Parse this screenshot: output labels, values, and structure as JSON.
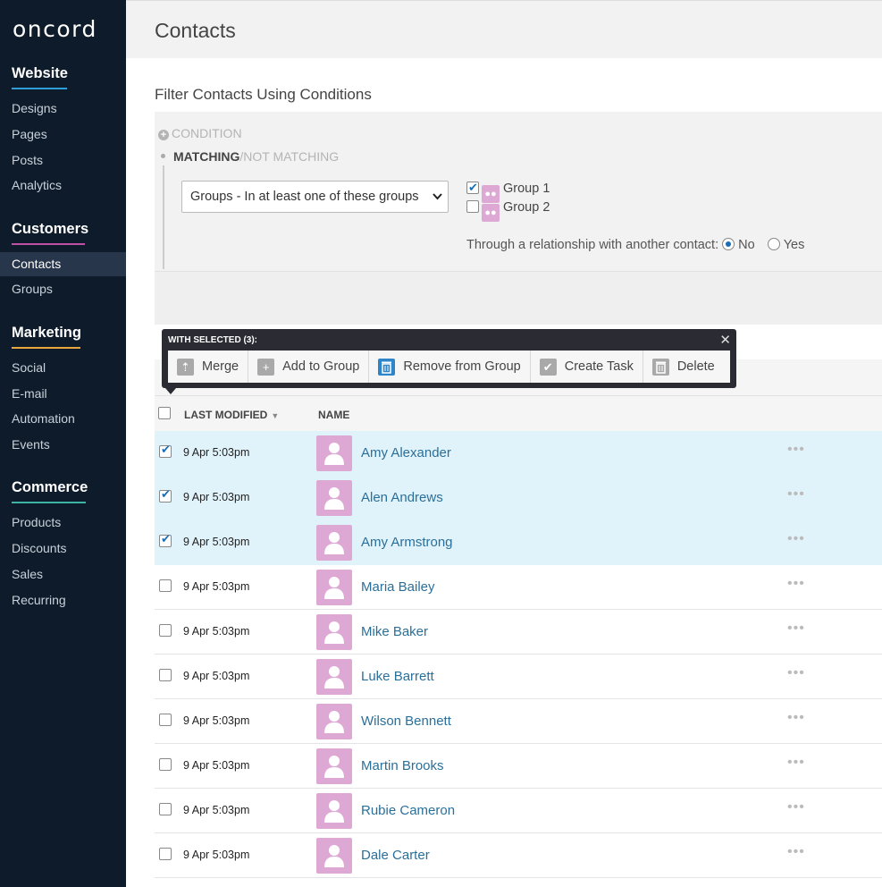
{
  "app": {
    "logo": "oncord"
  },
  "sidebar": {
    "sections": [
      {
        "title": "Website",
        "accent": "#2e9fd8",
        "items": [
          "Designs",
          "Pages",
          "Posts",
          "Analytics"
        ]
      },
      {
        "title": "Customers",
        "accent": "#c04fa6",
        "items": [
          "Contacts",
          "Groups"
        ]
      },
      {
        "title": "Marketing",
        "accent": "#e8a63c",
        "items": [
          "Social",
          "E-mail",
          "Automation",
          "Events"
        ]
      },
      {
        "title": "Commerce",
        "accent": "#3db5a6",
        "items": [
          "Products",
          "Discounts",
          "Sales",
          "Recurring"
        ]
      }
    ],
    "active": "Contacts"
  },
  "header": {
    "title": "Contacts"
  },
  "filter": {
    "heading": "Filter Contacts Using Conditions",
    "add_condition": "CONDITION",
    "matching": "MATCHING",
    "not_matching": "/NOT MATCHING",
    "select_value": "Groups - In at least one of these groups",
    "groups": [
      {
        "label": "Group 1",
        "checked": true
      },
      {
        "label": "Group 2",
        "checked": false
      }
    ],
    "relation_label": "Through a relationship with another contact:",
    "relation_no": "No",
    "relation_yes": "Yes",
    "relation_selected": "No"
  },
  "selection_bar": {
    "title": "WITH SELECTED (3):",
    "actions": [
      "Merge",
      "Add to Group",
      "Remove from Group",
      "Create Task",
      "Delete"
    ]
  },
  "table": {
    "columns": {
      "modified": "LAST MODIFIED",
      "name": "NAME"
    },
    "rows": [
      {
        "date": "9 Apr 5:03pm",
        "name": "Amy Alexander",
        "selected": true
      },
      {
        "date": "9 Apr 5:03pm",
        "name": "Alen Andrews",
        "selected": true
      },
      {
        "date": "9 Apr 5:03pm",
        "name": "Amy Armstrong",
        "selected": true
      },
      {
        "date": "9 Apr 5:03pm",
        "name": "Maria Bailey",
        "selected": false
      },
      {
        "date": "9 Apr 5:03pm",
        "name": "Mike Baker",
        "selected": false
      },
      {
        "date": "9 Apr 5:03pm",
        "name": "Luke Barrett",
        "selected": false
      },
      {
        "date": "9 Apr 5:03pm",
        "name": "Wilson Bennett",
        "selected": false
      },
      {
        "date": "9 Apr 5:03pm",
        "name": "Martin Brooks",
        "selected": false
      },
      {
        "date": "9 Apr 5:03pm",
        "name": "Rubie Cameron",
        "selected": false
      },
      {
        "date": "9 Apr 5:03pm",
        "name": "Dale Carter",
        "selected": false
      }
    ],
    "more_glyph": "•••"
  }
}
